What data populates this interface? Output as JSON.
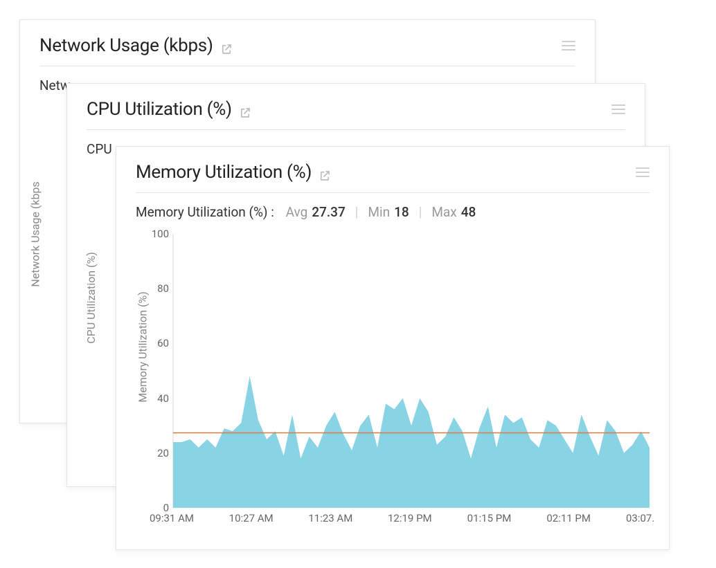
{
  "cards": {
    "network": {
      "title": "Network Usage (kbps)",
      "summary_prefix": "Netw",
      "axis_label": "Network Usage (kbps"
    },
    "cpu": {
      "title": "CPU Utilization (%)",
      "summary_prefix": "CPU",
      "axis_label": "CPU Utilization (%)"
    },
    "memory": {
      "title": "Memory Utilization (%)",
      "summary_label": "Memory Utilization (%) :",
      "avg_label": "Avg",
      "avg_value": "27.37",
      "min_label": "Min",
      "min_value": "18",
      "max_label": "Max",
      "max_value": "48",
      "axis_label": "Memory Utilization (%)"
    }
  },
  "chart_data": {
    "type": "area",
    "title": "Memory Utilization (%)",
    "xlabel": "",
    "ylabel": "Memory Utilization (%)",
    "ylim": [
      0,
      100
    ],
    "yticks": [
      0,
      20,
      40,
      60,
      80,
      100
    ],
    "x_tick_labels": [
      "09:31 AM",
      "10:27 AM",
      "11:23 AM",
      "12:19 PM",
      "01:15 PM",
      "02:11 PM",
      "03:07."
    ],
    "avg_line": 27.37,
    "series": [
      {
        "name": "Memory Utilization (%)",
        "values": [
          24,
          24,
          25,
          22,
          25,
          22,
          29,
          28,
          31,
          48,
          32,
          25,
          28,
          19,
          34,
          18,
          26,
          22,
          30,
          35,
          27,
          21,
          30,
          34,
          22,
          38,
          36,
          40,
          30,
          40,
          35,
          23,
          26,
          33,
          28,
          18,
          29,
          37,
          22,
          34,
          31,
          33,
          25,
          22,
          32,
          30,
          25,
          20,
          34,
          26,
          19,
          32,
          28,
          20,
          23,
          28,
          22
        ]
      }
    ]
  }
}
